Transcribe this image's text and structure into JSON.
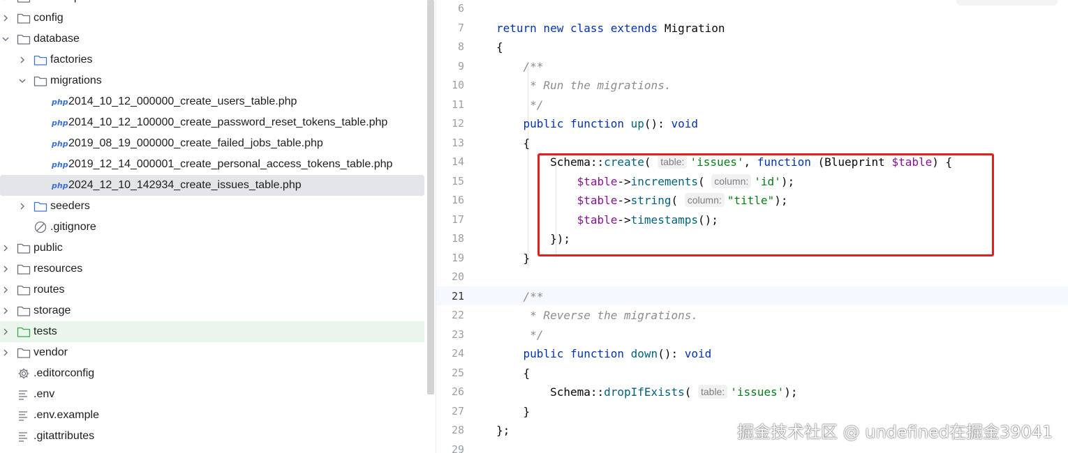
{
  "tree": [
    {
      "label": "bootstrap",
      "type": "folder",
      "depth": 0,
      "chevron": "right"
    },
    {
      "label": "config",
      "type": "folder",
      "depth": 0,
      "chevron": "right"
    },
    {
      "label": "database",
      "type": "folder",
      "depth": 0,
      "chevron": "down"
    },
    {
      "label": "factories",
      "type": "folder-blue",
      "depth": 1,
      "chevron": "right"
    },
    {
      "label": "migrations",
      "type": "folder",
      "depth": 1,
      "chevron": "down"
    },
    {
      "label": "2014_10_12_000000_create_users_table.php",
      "type": "php",
      "depth": 2
    },
    {
      "label": "2014_10_12_100000_create_password_reset_tokens_table.php",
      "type": "php",
      "depth": 2
    },
    {
      "label": "2019_08_19_000000_create_failed_jobs_table.php",
      "type": "php",
      "depth": 2
    },
    {
      "label": "2019_12_14_000001_create_personal_access_tokens_table.php",
      "type": "php",
      "depth": 2
    },
    {
      "label": "2024_12_10_142934_create_issues_table.php",
      "type": "php",
      "depth": 2,
      "selected": true
    },
    {
      "label": "seeders",
      "type": "folder-blue",
      "depth": 1,
      "chevron": "right"
    },
    {
      "label": ".gitignore",
      "type": "ignore",
      "depth": 1
    },
    {
      "label": "public",
      "type": "folder",
      "depth": 0,
      "chevron": "right"
    },
    {
      "label": "resources",
      "type": "folder",
      "depth": 0,
      "chevron": "right"
    },
    {
      "label": "routes",
      "type": "folder",
      "depth": 0,
      "chevron": "right"
    },
    {
      "label": "storage",
      "type": "folder",
      "depth": 0,
      "chevron": "right"
    },
    {
      "label": "tests",
      "type": "folder-green",
      "depth": 0,
      "chevron": "right",
      "highlight": true
    },
    {
      "label": "vendor",
      "type": "folder",
      "depth": 0,
      "chevron": "right"
    },
    {
      "label": ".editorconfig",
      "type": "gear",
      "depth": 0
    },
    {
      "label": ".env",
      "type": "text",
      "depth": 0
    },
    {
      "label": ".env.example",
      "type": "text",
      "depth": 0
    },
    {
      "label": ".gitattributes",
      "type": "text",
      "depth": 0
    }
  ],
  "php_badge": "php",
  "current_line": 21,
  "lines": [
    {
      "n": "6",
      "tokens": []
    },
    {
      "n": "7",
      "tokens": [
        [
          "kw",
          "return new class extends "
        ],
        [
          "p",
          "Migration"
        ]
      ]
    },
    {
      "n": "8",
      "tokens": [
        [
          "p",
          "{"
        ]
      ]
    },
    {
      "n": "9",
      "tokens": [
        [
          "p",
          "    "
        ],
        [
          "cm",
          "/**"
        ]
      ]
    },
    {
      "n": "10",
      "tokens": [
        [
          "p",
          "    "
        ],
        [
          "cm",
          " * Run the migrations."
        ]
      ]
    },
    {
      "n": "11",
      "tokens": [
        [
          "p",
          "    "
        ],
        [
          "cm",
          " */"
        ]
      ]
    },
    {
      "n": "12",
      "tokens": [
        [
          "p",
          "    "
        ],
        [
          "kw",
          "public function "
        ],
        [
          "fn",
          "up"
        ],
        [
          "p",
          "(): "
        ],
        [
          "kw",
          "void"
        ]
      ]
    },
    {
      "n": "13",
      "tokens": [
        [
          "p",
          "    {"
        ]
      ]
    },
    {
      "n": "14",
      "tokens": [
        [
          "p",
          "        Schema::"
        ],
        [
          "fn",
          "create"
        ],
        [
          "p",
          "( "
        ],
        [
          "hint",
          "table:"
        ],
        [
          "str",
          "'issues'"
        ],
        [
          "p",
          ", "
        ],
        [
          "kw",
          "function "
        ],
        [
          "p",
          "(Blueprint "
        ],
        [
          "var",
          "$table"
        ],
        [
          "p",
          ") {"
        ]
      ]
    },
    {
      "n": "15",
      "tokens": [
        [
          "p",
          "            "
        ],
        [
          "var",
          "$table"
        ],
        [
          "p",
          "->"
        ],
        [
          "fn",
          "increments"
        ],
        [
          "p",
          "( "
        ],
        [
          "hint",
          "column:"
        ],
        [
          "str",
          "'id'"
        ],
        [
          "p",
          ");"
        ]
      ]
    },
    {
      "n": "16",
      "tokens": [
        [
          "p",
          "            "
        ],
        [
          "var",
          "$table"
        ],
        [
          "p",
          "->"
        ],
        [
          "fn",
          "string"
        ],
        [
          "p",
          "( "
        ],
        [
          "hint",
          "column:"
        ],
        [
          "str",
          "\"title\""
        ],
        [
          "p",
          ");"
        ]
      ]
    },
    {
      "n": "17",
      "tokens": [
        [
          "p",
          "            "
        ],
        [
          "var",
          "$table"
        ],
        [
          "p",
          "->"
        ],
        [
          "fn",
          "timestamps"
        ],
        [
          "p",
          "();"
        ]
      ]
    },
    {
      "n": "18",
      "tokens": [
        [
          "p",
          "        });"
        ]
      ]
    },
    {
      "n": "19",
      "tokens": [
        [
          "p",
          "    }"
        ]
      ]
    },
    {
      "n": "20",
      "tokens": []
    },
    {
      "n": "21",
      "tokens": [
        [
          "p",
          "    "
        ],
        [
          "cm",
          "/**"
        ]
      ]
    },
    {
      "n": "22",
      "tokens": [
        [
          "p",
          "    "
        ],
        [
          "cm",
          " * Reverse the migrations."
        ]
      ]
    },
    {
      "n": "23",
      "tokens": [
        [
          "p",
          "    "
        ],
        [
          "cm",
          " */"
        ]
      ]
    },
    {
      "n": "24",
      "tokens": [
        [
          "p",
          "    "
        ],
        [
          "kw",
          "public function "
        ],
        [
          "fn",
          "down"
        ],
        [
          "p",
          "(): "
        ],
        [
          "kw",
          "void"
        ]
      ]
    },
    {
      "n": "25",
      "tokens": [
        [
          "p",
          "    {"
        ]
      ]
    },
    {
      "n": "26",
      "tokens": [
        [
          "p",
          "        Schema::"
        ],
        [
          "fn",
          "dropIfExists"
        ],
        [
          "p",
          "( "
        ],
        [
          "hint",
          "table:"
        ],
        [
          "str",
          "'issues'"
        ],
        [
          "p",
          ");"
        ]
      ]
    },
    {
      "n": "27",
      "tokens": [
        [
          "p",
          "    }"
        ]
      ]
    },
    {
      "n": "28",
      "tokens": [
        [
          "p",
          "};"
        ]
      ]
    },
    {
      "n": "29",
      "tokens": []
    }
  ],
  "watermark": "掘金技术社区 @ undefined在掘金39041"
}
